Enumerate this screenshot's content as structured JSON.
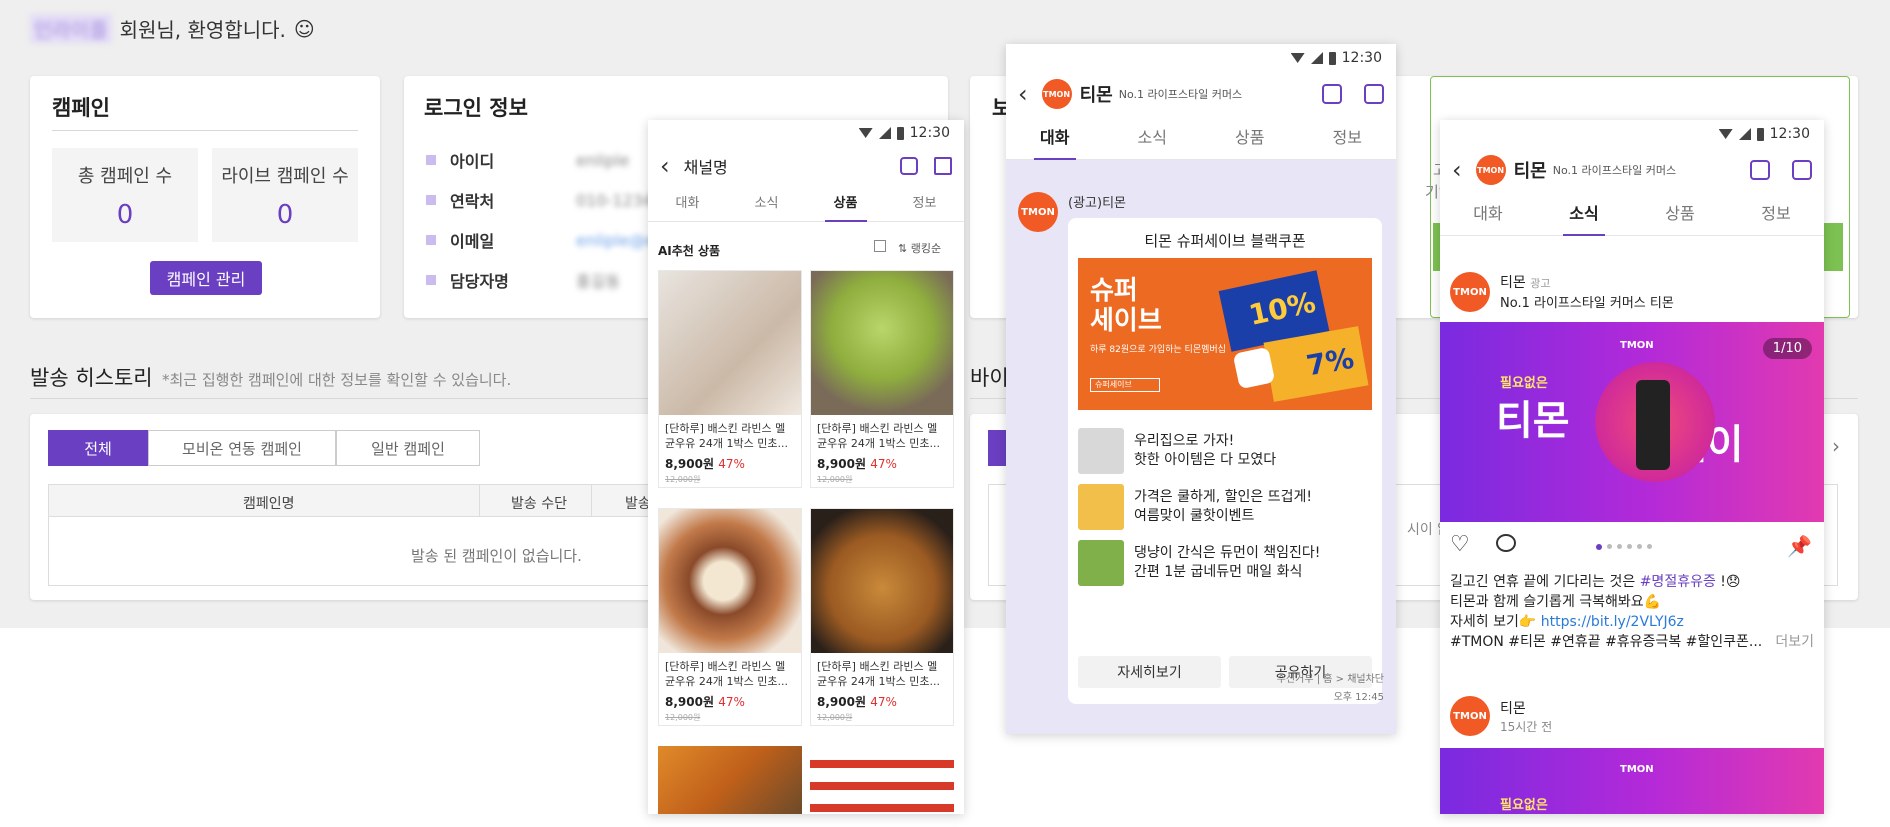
{
  "welcome": {
    "name": "인라이플",
    "text": "회원님, 환영합니다.",
    "smile": "☺"
  },
  "campaign": {
    "title": "캠페인",
    "total_label": "총 캠페인 수",
    "total_value": "0",
    "live_label": "라이브 캠페인 수",
    "live_value": "0",
    "manage_button": "캠페인 관리"
  },
  "login": {
    "title": "로그인 정보",
    "rows": [
      {
        "label": "아이디",
        "value": "enliple"
      },
      {
        "label": "연락처",
        "value": "010-1234-5678"
      },
      {
        "label": "이메일",
        "value": "enliple@enliple.com"
      },
      {
        "label": "담당자명",
        "value": "홍길동"
      }
    ]
  },
  "third_card": {
    "title_fragment": "보",
    "text1": "고",
    "text2": "기업 전"
  },
  "history": {
    "title": "발송 히스토리",
    "subtitle": "*최근 집행한 캠페인에 대한 정보를 확인할 수 있습니다.",
    "tabs": [
      "전체",
      "모비온 연동 캠페인",
      "일반 캠페인"
    ],
    "columns": [
      "캠페인명",
      "발송 수단",
      "발송"
    ],
    "empty": "발송 된 캠페인이 없습니다."
  },
  "right_section": {
    "title_fragment": "바이",
    "empty_fragment": "시이 없",
    "arrow": "›"
  },
  "phone1": {
    "time": "12:30",
    "channel": "채널명",
    "tabs": [
      "대화",
      "소식",
      "상품",
      "정보"
    ],
    "active_tab": 2,
    "section": "AI추천 상품",
    "sort": "랭킹순",
    "products": [
      {
        "name": "[단하루] 배스킨 라빈스 멜균우유 24개 1박스 민초...",
        "price": "8,900원",
        "discount": "47%",
        "orig": "12,000원"
      },
      {
        "name": "[단하루] 배스킨 라빈스 멜균우유 24개 1박스 민초...",
        "price": "8,900원",
        "discount": "47%",
        "orig": "12,000원"
      },
      {
        "name": "[단하루] 배스킨 라빈스 멜균우유 24개 1박스 민초...",
        "price": "8,900원",
        "discount": "47%",
        "orig": "12,000원"
      },
      {
        "name": "[단하루] 배스킨 라빈스 멜균우유 24개 1박스 민초...",
        "price": "8,900원",
        "discount": "47%",
        "orig": "12,000원"
      }
    ]
  },
  "phone2": {
    "time": "12:30",
    "brand": "티몬",
    "tagline": "No.1 라이프스타일 커머스",
    "logo_text": "TMON",
    "tabs": [
      "대화",
      "소식",
      "상품",
      "정보"
    ],
    "active_tab": 0,
    "sender": "(광고)티몬",
    "card_title": "티몬 슈퍼세이브 블랙쿠폰",
    "banner_title": "슈퍼\n세이브",
    "banner_sub": "하루 82원으로 가입하는 티몬멤버십",
    "banner_search": "슈퍼세이브",
    "pct1": "10%",
    "pct2": "7%",
    "items": [
      {
        "line1": "우리집으로 가자!",
        "line2": "핫한 아이템은 다 모였다"
      },
      {
        "line1": "가격은 쿨하게, 할인은 뜨겁게!",
        "line2": "여름맞이 쿨핫이벤트"
      },
      {
        "line1": "댕냥이 간식은 듀먼이 책임진다!",
        "line2": "간편 1분 굽네듀먼 매일 화식"
      }
    ],
    "btn_detail": "자세히보기",
    "btn_share": "공유하기",
    "footer": "수신거부 | 홈 > 채널차단",
    "footer_time": "오후 12:45"
  },
  "phone3": {
    "time": "12:30",
    "brand": "티몬",
    "tagline": "No.1 라이프스타일 커머스",
    "logo_text": "TMON",
    "tabs": [
      "대화",
      "소식",
      "상품",
      "정보"
    ],
    "active_tab": 1,
    "post_name": "티몬",
    "post_ad": "광고",
    "post_sub": "No.1 라이프스타일 커머스 티몬",
    "banner_counter": "1/10",
    "banner_small": "필요없은",
    "banner_big1": "티몬",
    "banner_big2": "데이",
    "banner_brand": "TMON",
    "caption1": "길고긴 연휴 끝에 기다리는 것은",
    "hashtag1": "#명절휴유증",
    "caption1_end": "!😞",
    "caption2": "티몬과 함께 슬기롭게 극복해봐요💪",
    "caption3": "자세히 보기👉",
    "link": "https://bit.ly/2VLYJ6z",
    "tags": "#TMON #티몬 #연휴끝 #휴유증극복 #할인쿠폰...",
    "more": "더보기",
    "post2_name": "티몬",
    "post2_time": "15시간 전"
  },
  "colors": {
    "accent": "#6a3fc1",
    "tmon": "#f15a24",
    "green_border": "#7cc152"
  }
}
